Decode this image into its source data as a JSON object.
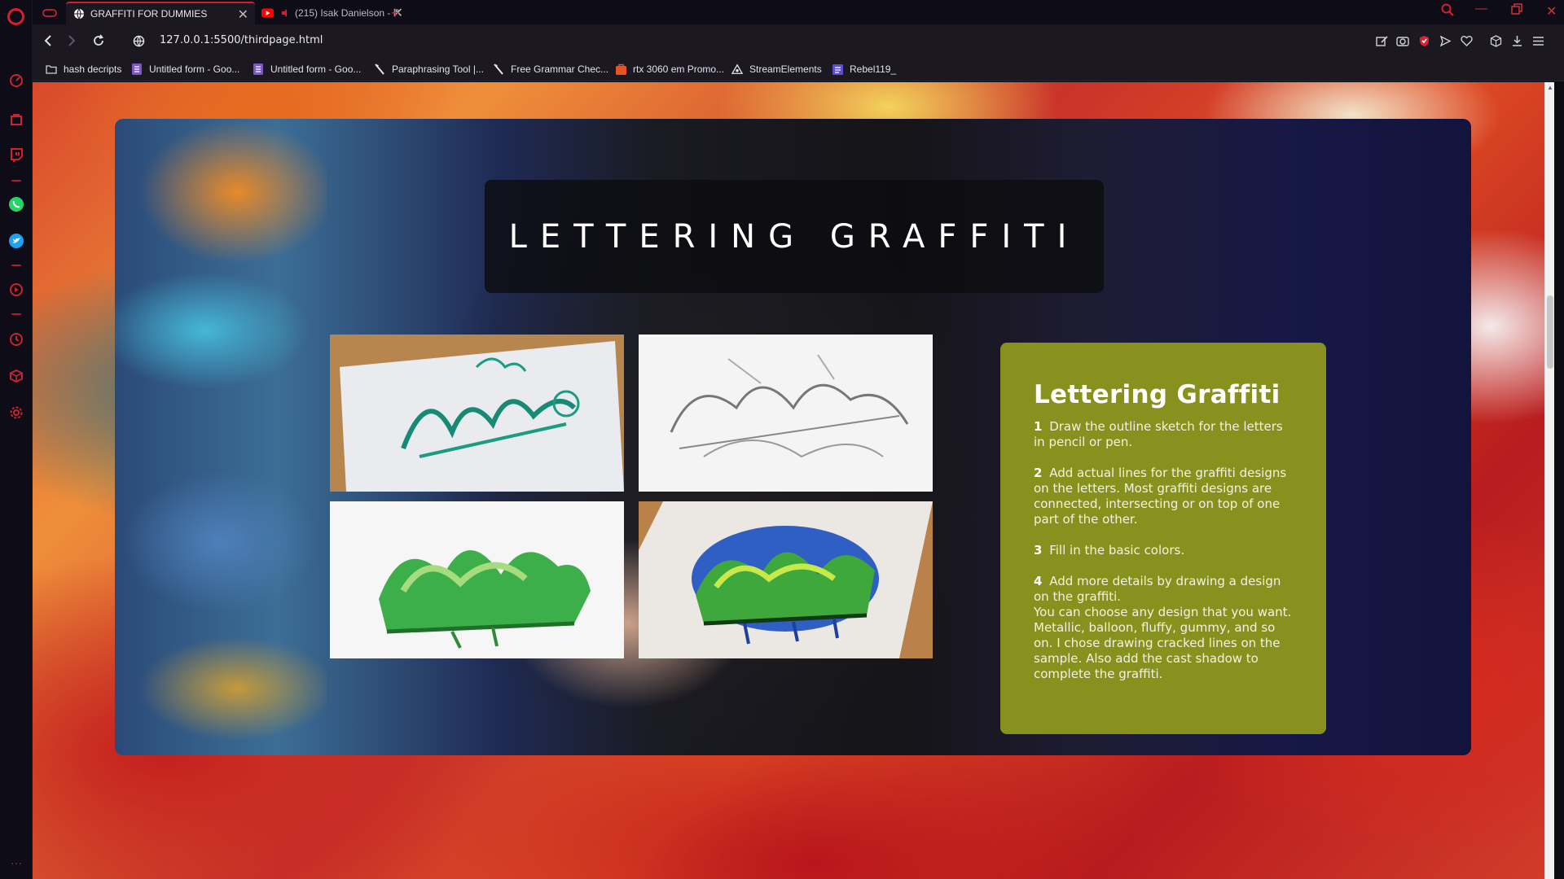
{
  "browser": {
    "tabs": [
      {
        "title": "GRAFFITI FOR DUMMIES",
        "active": true,
        "icon": "globe-icon"
      },
      {
        "title": "(215) Isak Danielson - P",
        "active": false,
        "icon": "youtube-icon"
      }
    ],
    "new_tab_symbol": "+",
    "url": "127.0.0.1:5500/thirdpage.html",
    "accent_color": "#d4202c",
    "bookmarks": [
      {
        "label": "hash decripts",
        "icon": "folder-icon"
      },
      {
        "label": "Untitled form - Goo...",
        "icon": "google-forms-icon"
      },
      {
        "label": "Untitled form - Goo...",
        "icon": "google-forms-icon"
      },
      {
        "label": "Paraphrasing Tool |...",
        "icon": "quill-icon"
      },
      {
        "label": "Free Grammar Chec...",
        "icon": "quill-icon"
      },
      {
        "label": "rtx 3060 em Promo...",
        "icon": "shop-icon"
      },
      {
        "label": "StreamElements",
        "icon": "streamelements-icon"
      },
      {
        "label": "Rebel119_",
        "icon": "bookmark-page-icon"
      }
    ]
  },
  "page": {
    "title": "LETTERING GRAFFITI",
    "gallery_images": [
      {
        "description": "teal ink graffiti sketch on paper",
        "icon": "sketch-teal"
      },
      {
        "description": "pencil outline graffiti sketch",
        "icon": "sketch-pencil"
      },
      {
        "description": "green filled graffiti letters",
        "icon": "sketch-green"
      },
      {
        "description": "detailed green and blue graffiti piece",
        "icon": "sketch-detailed"
      }
    ],
    "info": {
      "heading": "Lettering Graffiti",
      "steps": [
        {
          "num": "1",
          "text": "Draw the outline sketch for the letters in pencil or pen."
        },
        {
          "num": "2",
          "text": "Add actual lines for the graffiti designs on the letters. Most graffiti designs are connected, intersecting or on top of one part of the other."
        },
        {
          "num": "3",
          "text": "Fill in the basic colors."
        },
        {
          "num": "4",
          "text": "Add more details by drawing a design on the graffiti.",
          "extra": "You can choose any design that you want. Metallic, balloon, fluffy, gummy, and so on. I chose drawing cracked lines on the sample. Also add the cast shadow to complete the graffiti."
        }
      ],
      "panel_color": "#88911d"
    }
  }
}
